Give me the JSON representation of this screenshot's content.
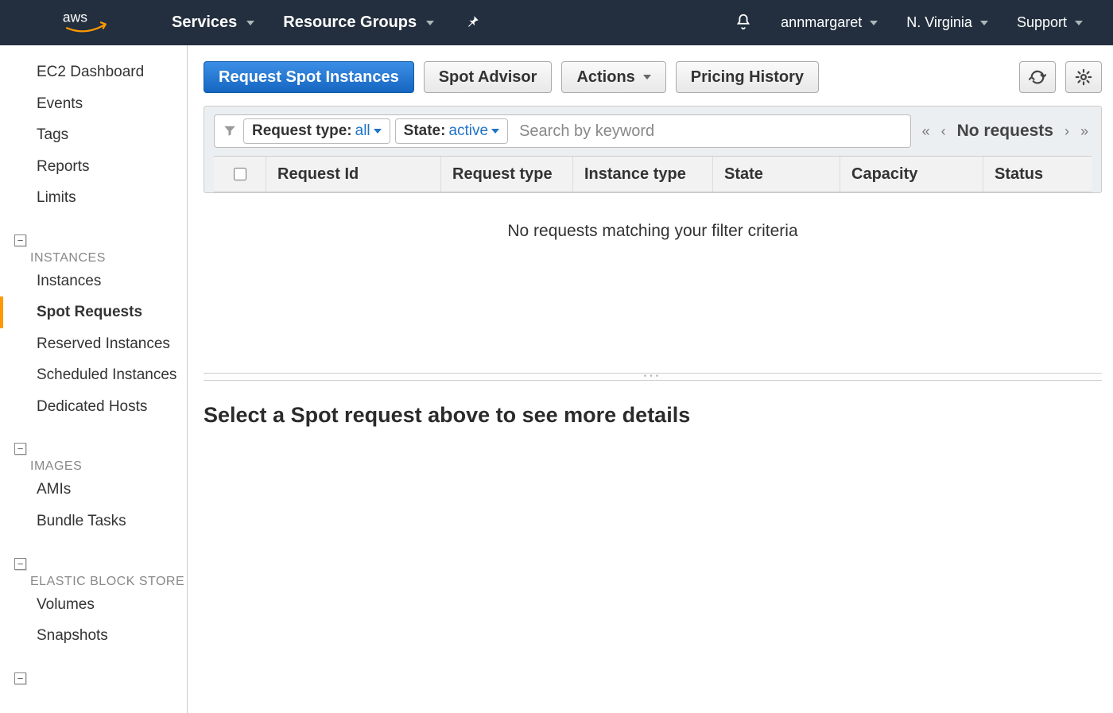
{
  "topnav": {
    "services": "Services",
    "resource_groups": "Resource Groups",
    "user": "annmargaret",
    "region": "N. Virginia",
    "support": "Support"
  },
  "sidebar": {
    "top": [
      "EC2 Dashboard",
      "Events",
      "Tags",
      "Reports",
      "Limits"
    ],
    "groups": [
      {
        "title": "INSTANCES",
        "items": [
          "Instances",
          "Spot Requests",
          "Reserved Instances",
          "Scheduled Instances",
          "Dedicated Hosts"
        ],
        "active_index": 1
      },
      {
        "title": "IMAGES",
        "items": [
          "AMIs",
          "Bundle Tasks"
        ]
      },
      {
        "title": "ELASTIC BLOCK STORE",
        "items": [
          "Volumes",
          "Snapshots"
        ]
      }
    ]
  },
  "toolbar": {
    "request_spot": "Request Spot Instances",
    "spot_advisor": "Spot Advisor",
    "actions": "Actions",
    "pricing_history": "Pricing History"
  },
  "filters": {
    "request_type_label": "Request type:",
    "request_type_value": "all",
    "state_label": "State:",
    "state_value": "active",
    "search_placeholder": "Search by keyword",
    "pager_label": "No requests"
  },
  "table": {
    "columns": [
      "Request Id",
      "Request type",
      "Instance type",
      "State",
      "Capacity",
      "Status"
    ],
    "empty_message": "No requests matching your filter criteria"
  },
  "details": {
    "prompt": "Select a Spot request above to see more details"
  }
}
